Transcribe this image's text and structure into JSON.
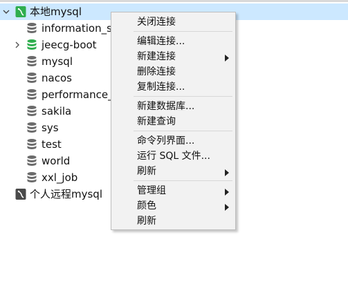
{
  "tree": {
    "root": {
      "label": "本地mysql",
      "expanded": true,
      "color": "#2fae4e"
    },
    "databases": [
      {
        "label": "information_s",
        "active": false
      },
      {
        "label": "jeecg-boot",
        "active": true
      },
      {
        "label": "mysql",
        "active": false
      },
      {
        "label": "nacos",
        "active": false
      },
      {
        "label": "performance_",
        "active": false
      },
      {
        "label": "sakila",
        "active": false
      },
      {
        "label": "sys",
        "active": false
      },
      {
        "label": "test",
        "active": false
      },
      {
        "label": "world",
        "active": false
      },
      {
        "label": "xxl_job",
        "active": false
      }
    ],
    "second_connection": {
      "label": "个人远程mysql",
      "color": "#4a4a4a"
    }
  },
  "context_menu": {
    "items": [
      {
        "label": "关闭连接",
        "submenu": false
      },
      {
        "label": "编辑连接...",
        "submenu": false
      },
      {
        "label": "新建连接",
        "submenu": true
      },
      {
        "label": "删除连接",
        "submenu": false
      },
      {
        "label": "复制连接...",
        "submenu": false
      },
      {
        "label": "新建数据库...",
        "submenu": false
      },
      {
        "label": "新建查询",
        "submenu": false
      },
      {
        "label": "命令列界面...",
        "submenu": false
      },
      {
        "label": "运行 SQL 文件...",
        "submenu": false
      },
      {
        "label": "刷新",
        "submenu": true
      },
      {
        "label": "管理组",
        "submenu": true
      },
      {
        "label": "颜色",
        "submenu": true
      },
      {
        "label": "刷新",
        "submenu": false
      }
    ]
  },
  "colors": {
    "selection": "#cce8ff",
    "db_active": "#2fae4e",
    "db_inactive": "#6b6b6b"
  }
}
